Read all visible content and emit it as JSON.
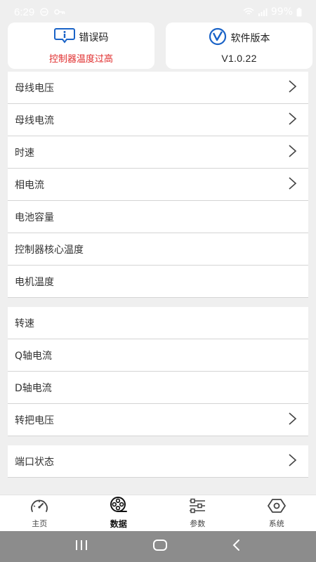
{
  "status_bar": {
    "time": "6:29",
    "battery": "99%"
  },
  "cards": {
    "error": {
      "title": "错误码",
      "value": "控制器温度过高",
      "value_color": "#e02d2d"
    },
    "version": {
      "title": "软件版本",
      "value": "V1.0.22"
    }
  },
  "groups": [
    {
      "items": [
        {
          "label": "母线电压",
          "chevron": true
        },
        {
          "label": "母线电流",
          "chevron": true
        },
        {
          "label": "时速",
          "chevron": true
        },
        {
          "label": "相电流",
          "chevron": true
        },
        {
          "label": "电池容量",
          "chevron": false
        },
        {
          "label": "控制器核心温度",
          "chevron": false
        },
        {
          "label": "电机温度",
          "chevron": false
        }
      ]
    },
    {
      "items": [
        {
          "label": "转速",
          "chevron": false
        },
        {
          "label": "Q轴电流",
          "chevron": false
        },
        {
          "label": "D轴电流",
          "chevron": false
        },
        {
          "label": "转把电压",
          "chevron": true
        }
      ]
    },
    {
      "items": [
        {
          "label": "端口状态",
          "chevron": true
        }
      ]
    }
  ],
  "bottom_nav": [
    {
      "label": "主页",
      "icon": "speedometer-icon",
      "active": false
    },
    {
      "label": "数据",
      "icon": "film-reel-icon",
      "active": true
    },
    {
      "label": "参数",
      "icon": "sliders-icon",
      "active": false
    },
    {
      "label": "系统",
      "icon": "hexagon-nut-icon",
      "active": false
    }
  ],
  "colors": {
    "accent_blue": "#1a63c7",
    "error_red": "#e02d2d",
    "background": "#efefef"
  }
}
